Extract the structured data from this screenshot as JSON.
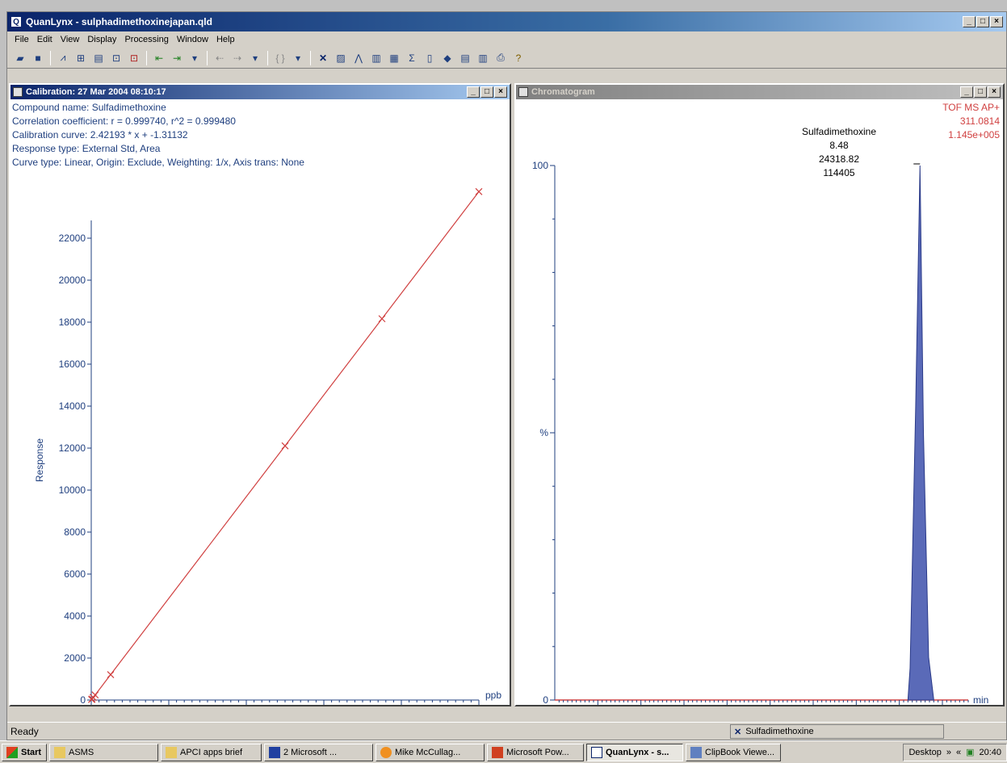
{
  "app": {
    "title": "QuanLynx - sulphadimethoxinejapan.qld",
    "icon_letter": "Q",
    "menu": [
      "File",
      "Edit",
      "View",
      "Display",
      "Processing",
      "Window",
      "Help"
    ],
    "status": "Ready",
    "status_compound": "Sulfadimethoxine"
  },
  "calibration": {
    "title": "Calibration: 27 Mar 2004 08:10:17",
    "info": [
      "Compound name: Sulfadimethoxine",
      "Correlation coefficient: r = 0.999740, r^2 = 0.999480",
      "Calibration curve: 2.42193 * x + -1.31132",
      "Response type: External Std, Area",
      "Curve type: Linear, Origin: Exclude, Weighting: 1/x, Axis trans: None"
    ]
  },
  "chromatogram": {
    "title": "Chromatogram",
    "header_lines": [
      "TOF MS AP+",
      "311.0814",
      "1.145e+005"
    ],
    "peak_label": [
      "Sulfadimethoxine",
      "8.48",
      "24318.82",
      "114405"
    ]
  },
  "chart_data": [
    {
      "type": "scatter",
      "title": "",
      "xlabel": "ppb",
      "ylabel": "Response",
      "xlim": [
        0,
        10000
      ],
      "ylim": [
        0,
        24000
      ],
      "x_ticks": [
        0,
        2000,
        4000,
        6000,
        8000,
        10000
      ],
      "y_ticks": [
        0,
        2000,
        4000,
        6000,
        8000,
        10000,
        12000,
        14000,
        16000,
        18000,
        20000,
        22000
      ],
      "points": [
        [
          10,
          24
        ],
        [
          20,
          48
        ],
        [
          50,
          121
        ],
        [
          100,
          241
        ],
        [
          500,
          1210
        ],
        [
          5000,
          12108
        ],
        [
          7500,
          18163
        ],
        [
          10000,
          24218
        ]
      ],
      "fit": {
        "slope": 2.42193,
        "intercept": -1.31132
      },
      "color": "#d04040"
    },
    {
      "type": "area",
      "title": "",
      "xlabel": "min",
      "ylabel": "%",
      "xlim": [
        0,
        9.6
      ],
      "ylim": [
        0,
        100
      ],
      "x_ticks": [
        1.0,
        2.0,
        3.0,
        4.0,
        5.0,
        6.0,
        7.0,
        8.0,
        9.0
      ],
      "y_ticks": [
        0,
        100
      ],
      "peak": {
        "start": 8.2,
        "apex": 8.48,
        "end": 8.8,
        "height": 100
      },
      "fill_color": "#5a6ab8",
      "baseline_color": "#d04040"
    }
  ],
  "taskbar": {
    "start": "Start",
    "items": [
      {
        "label": "ASMS",
        "pressed": false
      },
      {
        "label": "APCI apps brief",
        "pressed": false
      },
      {
        "label": "2 Microsoft ...",
        "pressed": false
      },
      {
        "label": "Mike McCullag...",
        "pressed": false
      },
      {
        "label": "Microsoft Pow...",
        "pressed": false
      },
      {
        "label": "QuanLynx - s...",
        "pressed": true
      },
      {
        "label": "ClipBook Viewe...",
        "pressed": false
      }
    ],
    "desktop": "Desktop",
    "clock": "20:40"
  }
}
